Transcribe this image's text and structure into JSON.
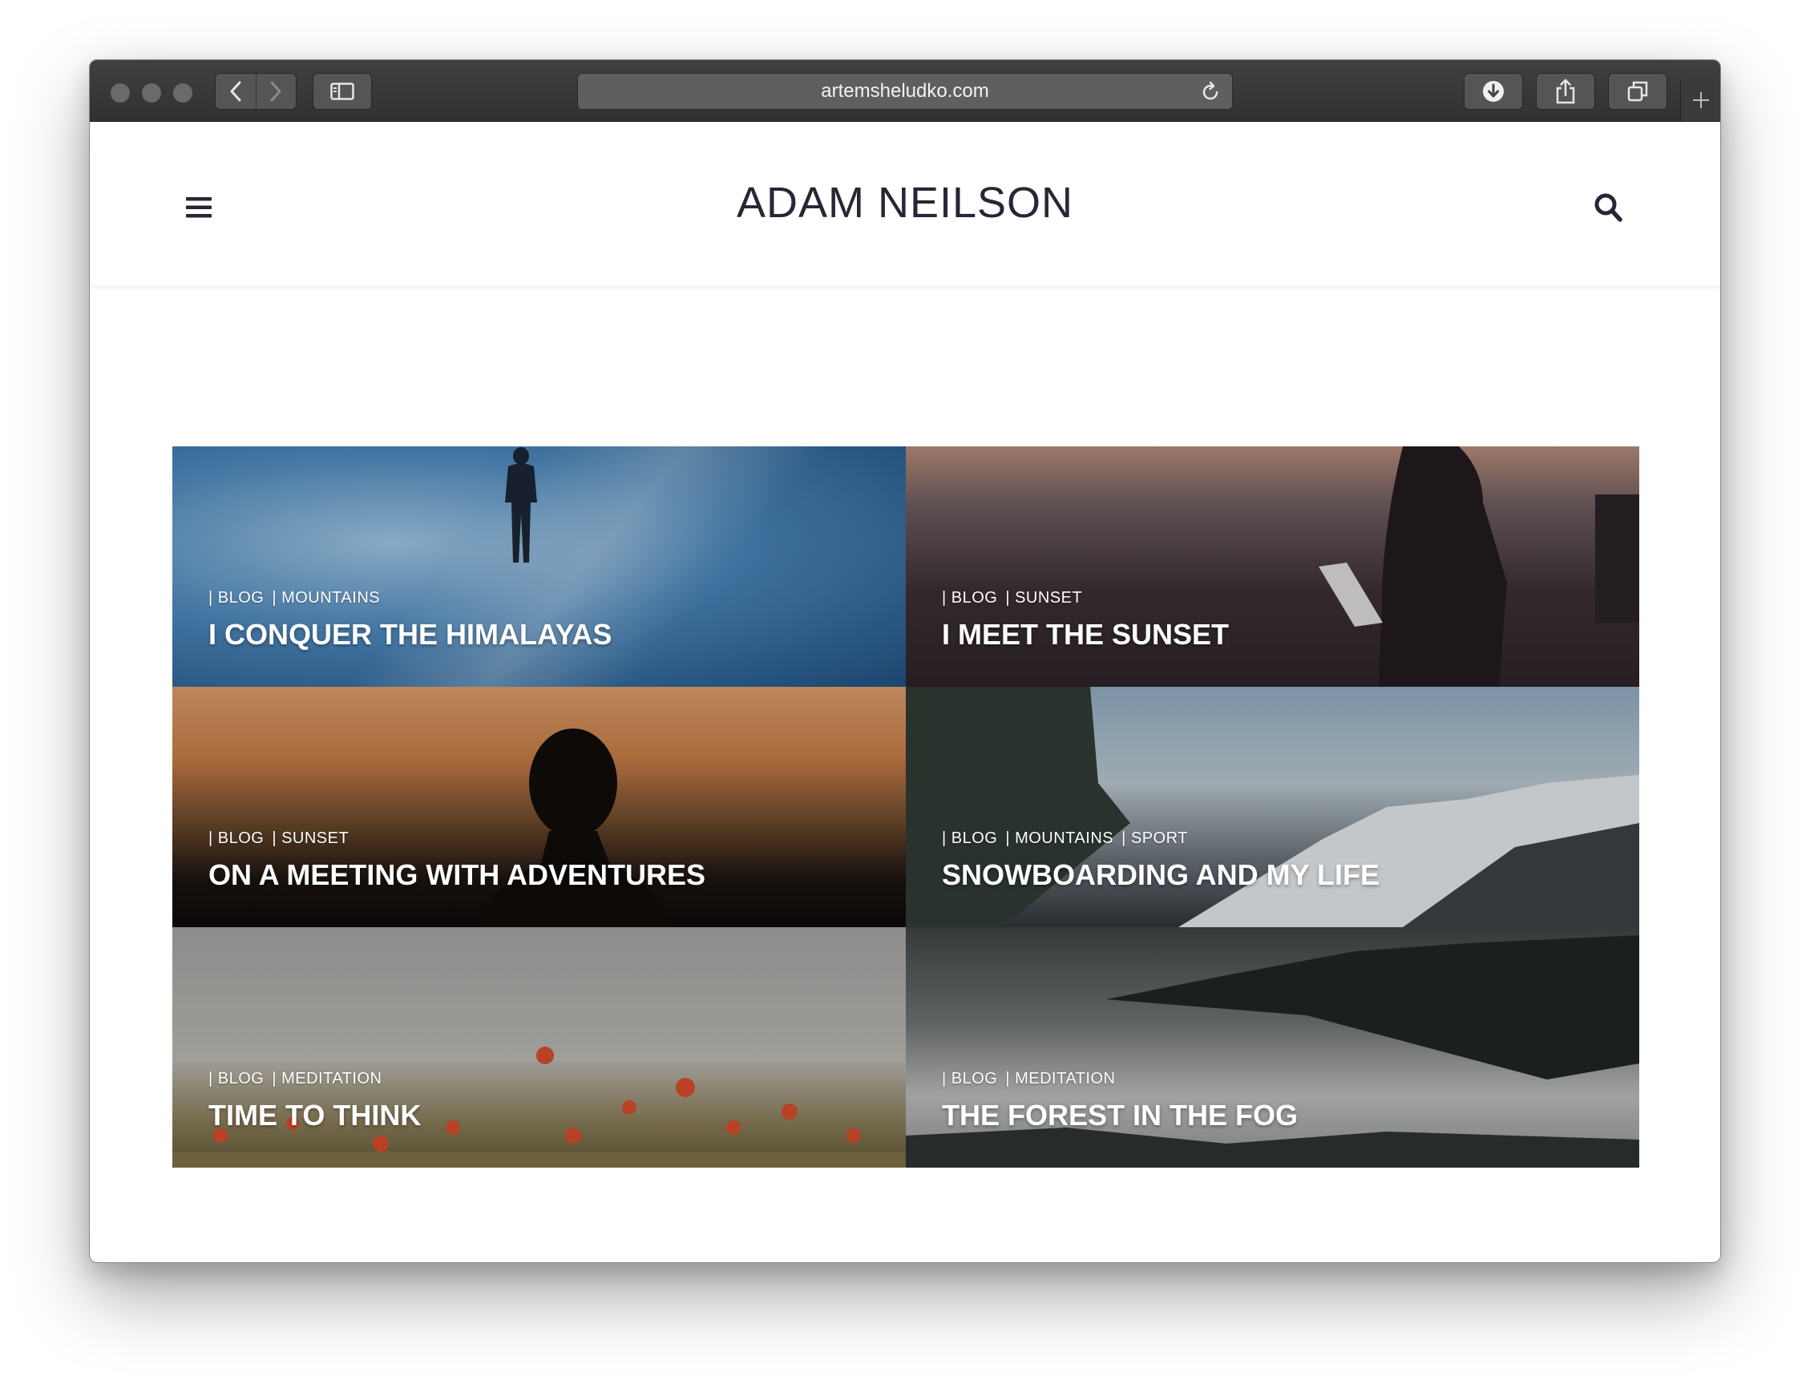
{
  "browser": {
    "url": "artemsheludko.com"
  },
  "header": {
    "site_title": "ADAM NEILSON"
  },
  "posts": [
    {
      "tags": [
        "| BLOG",
        "| MOUNTAINS"
      ],
      "title": "I CONQUER THE HIMALAYAS"
    },
    {
      "tags": [
        "| BLOG",
        "| SUNSET"
      ],
      "title": "I MEET THE SUNSET"
    },
    {
      "tags": [
        "| BLOG",
        "| SUNSET"
      ],
      "title": "ON A MEETING WITH ADVENTURES"
    },
    {
      "tags": [
        "| BLOG",
        "| MOUNTAINS",
        "| SPORT"
      ],
      "title": "SNOWBOARDING AND MY LIFE"
    },
    {
      "tags": [
        "| BLOG",
        "| MEDITATION"
      ],
      "title": "TIME TO THINK"
    },
    {
      "tags": [
        "| BLOG",
        "| MEDITATION"
      ],
      "title": "THE FOREST IN THE FOG"
    }
  ],
  "colors": {
    "title_text": "#2b2436",
    "titlebar": "#353535"
  }
}
